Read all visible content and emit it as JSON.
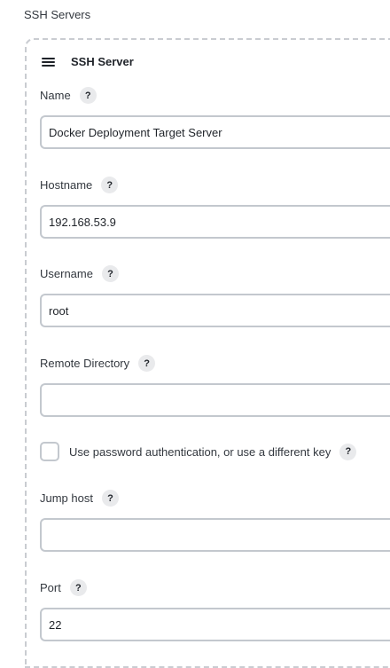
{
  "section": {
    "title": "SSH Servers"
  },
  "card": {
    "title": "SSH Server"
  },
  "fields": {
    "name": {
      "label": "Name",
      "value": "Docker Deployment Target Server",
      "help": "?"
    },
    "hostname": {
      "label": "Hostname",
      "value": "192.168.53.9",
      "help": "?"
    },
    "username": {
      "label": "Username",
      "value": "root",
      "help": "?"
    },
    "remote_directory": {
      "label": "Remote Directory",
      "value": "",
      "help": "?"
    },
    "use_password": {
      "label": "Use password authentication, or use a different key",
      "checked": false,
      "help": "?"
    },
    "jump_host": {
      "label": "Jump host",
      "value": "",
      "help": "?"
    },
    "port": {
      "label": "Port",
      "value": "22",
      "help": "?"
    }
  }
}
